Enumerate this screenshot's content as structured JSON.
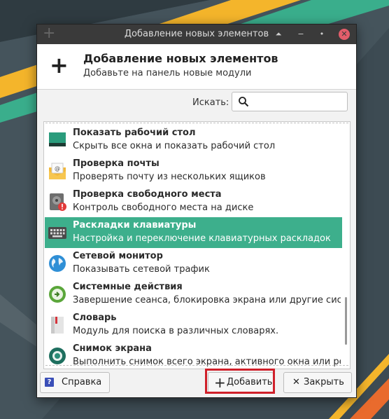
{
  "window": {
    "title": "Добавление новых элементов",
    "header_title": "Добавление новых элементов",
    "header_subtitle": "Добавьте на панель новые модули",
    "titlebar_buttons": [
      "shade",
      "menu",
      "close"
    ]
  },
  "search": {
    "label": "Искать:",
    "value": ""
  },
  "items": [
    {
      "name": "Показать рабочий стол",
      "desc": "Скрыть все окна и показать рабочий стол",
      "icon": "desktop-icon",
      "selected": false
    },
    {
      "name": "Проверка почты",
      "desc": "Проверять почту из нескольких ящиков",
      "icon": "mail-icon",
      "selected": false
    },
    {
      "name": "Проверка свободного места",
      "desc": "Контроль свободного места на диске",
      "icon": "disk-warning-icon",
      "selected": false
    },
    {
      "name": "Раскладки клавиатуры",
      "desc": "Настройка и переключение клавиатурных раскладок",
      "icon": "keyboard-icon",
      "selected": true
    },
    {
      "name": "Сетевой монитор",
      "desc": "Показывать сетевой трафик",
      "icon": "globe-icon",
      "selected": false
    },
    {
      "name": "Системные действия",
      "desc": "Завершение сеанса, блокировка экрана или другие систе…",
      "icon": "power-actions-icon",
      "selected": false
    },
    {
      "name": "Словарь",
      "desc": "Модуль для поиска в различных словарях.",
      "icon": "dictionary-icon",
      "selected": false
    },
    {
      "name": "Снимок экрана",
      "desc": "Выполнить снимок всего экрана, активного окна или рег…",
      "icon": "camera-icon",
      "selected": false
    }
  ],
  "buttons": {
    "help": "Справка",
    "add": "Добавить",
    "close": "Закрыть"
  },
  "colors": {
    "selection": "#3daf8c",
    "titlebar": "#3a3a3a",
    "close_button": "#e35d6a",
    "highlight_border": "#d0202a"
  }
}
